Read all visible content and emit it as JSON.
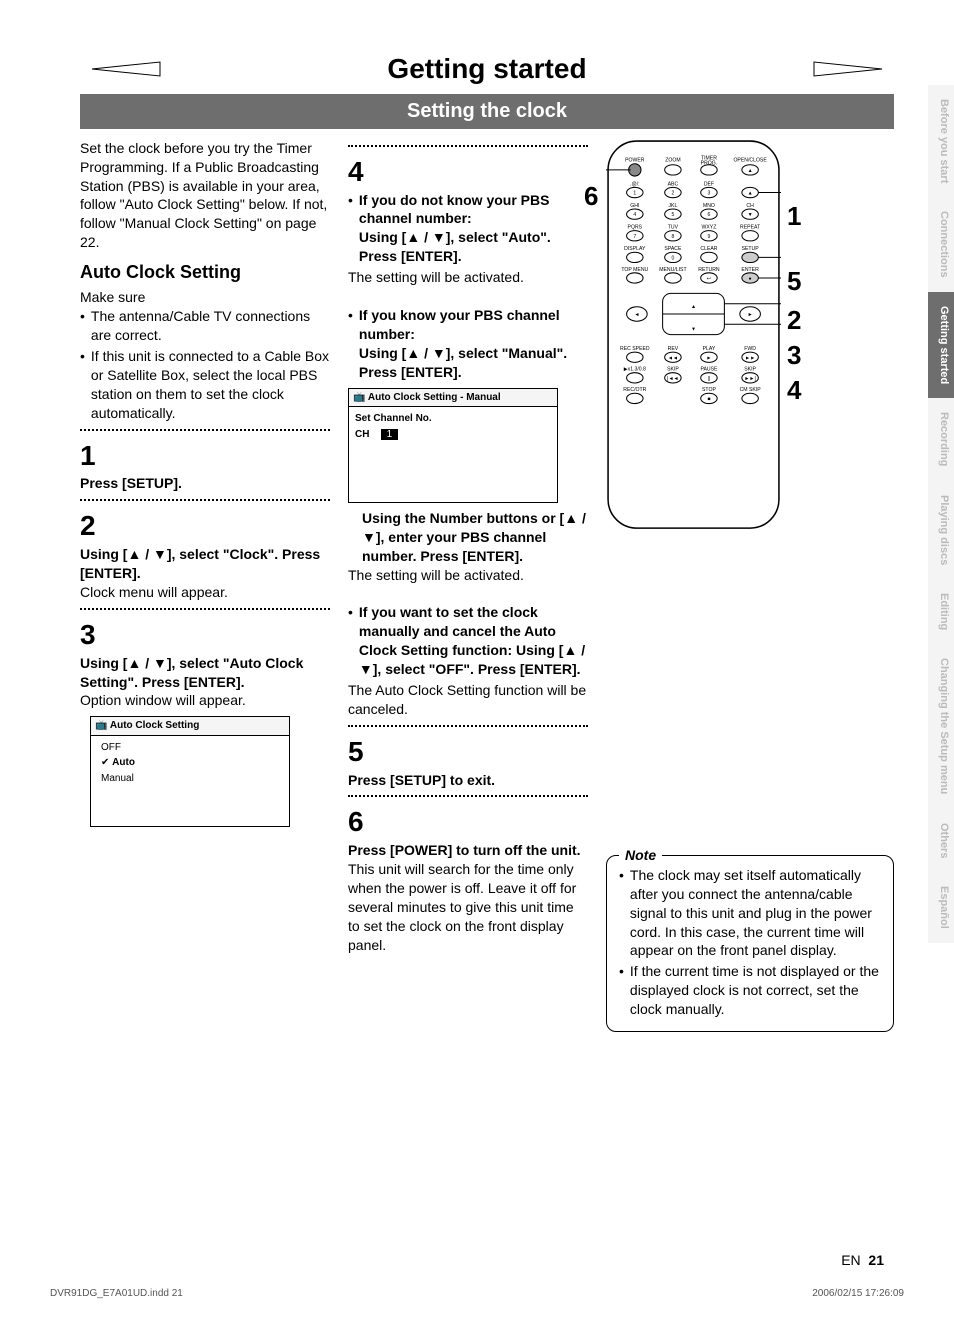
{
  "header": {
    "title": "Getting started",
    "subtitle": "Setting the clock"
  },
  "intro": "Set the clock before you try the Timer Programming. If a Public Broadcasting Station (PBS) is available in your area, follow \"Auto Clock Setting\" below. If not, follow \"Manual Clock Setting\" on page 22.",
  "autoClock": {
    "heading": "Auto Clock Setting",
    "makeSure": "Make sure",
    "bullets": [
      "The antenna/Cable TV connections are correct.",
      "If this unit is connected to a Cable Box or Satellite Box, select the local PBS station on them to set the clock automatically."
    ]
  },
  "steps": {
    "s1": {
      "num": "1",
      "bold": "Press [SETUP]."
    },
    "s2": {
      "num": "2",
      "bold": "Using [▲ / ▼], select \"Clock\". Press [ENTER].",
      "text": "Clock menu will appear."
    },
    "s3": {
      "num": "3",
      "bold": "Using [▲ / ▼], select \"Auto Clock Setting\". Press [ENTER].",
      "text": "Option window will appear."
    },
    "s4": {
      "num": "4",
      "b1_bold": "If you do not know your PBS channel number:",
      "b1_line": "Using [▲ / ▼], select \"Auto\". Press [ENTER].",
      "b1_text": "The setting will be activated.",
      "b2_bold": "If you know your PBS channel number:",
      "b2_line": "Using [▲ / ▼], select \"Manual\". Press [ENTER].",
      "num_bold": "Using the Number buttons or [▲ / ▼], enter your PBS channel number. Press [ENTER].",
      "num_text": "The setting will be activated.",
      "b3_bold": "If you want to set the clock manually and cancel the Auto Clock Setting function: Using [▲ / ▼], select \"OFF\". Press [ENTER].",
      "b3_text": "The Auto Clock Setting function will be canceled."
    },
    "s5": {
      "num": "5",
      "bold": "Press [SETUP] to exit."
    },
    "s6": {
      "num": "6",
      "bold": "Press [POWER] to turn off the unit.",
      "text": "This unit will search for the time only when the power is off. Leave it off for several minutes to give this unit time to set the clock on the front display panel."
    }
  },
  "osd1": {
    "title": "Auto Clock Setting",
    "items": [
      "OFF",
      "Auto",
      "Manual"
    ]
  },
  "osd2": {
    "title": "Auto Clock Setting - Manual",
    "line1": "Set Channel No.",
    "chLabel": "CH",
    "chVal": "1"
  },
  "note": {
    "title": "Note",
    "items": [
      "The clock may set itself automatically after you connect the antenna/cable signal to this unit and plug in the power cord. In this case, the current time will appear on the front panel display.",
      "If the current time is not displayed or the displayed clock is not correct, set the clock manually."
    ]
  },
  "remoteCallouts": {
    "c6": "6",
    "c1": "1",
    "c5": "5",
    "c2": "2",
    "c3": "3",
    "c4": "4"
  },
  "tabs": {
    "items": [
      "Before you start",
      "Connections",
      "Getting started",
      "Recording",
      "Playing discs",
      "Editing",
      "Changing the Setup menu",
      "Others",
      "Español"
    ]
  },
  "footer": {
    "lang": "EN",
    "page": "21"
  },
  "footerMeta": {
    "left": "DVR91DG_E7A01UD.indd   21",
    "right": "2006/02/15   17:26:09"
  },
  "remoteLabels": {
    "r1": [
      "POWER",
      "ZOOM",
      "TIMER PROG.",
      "OPEN/CLOSE"
    ],
    "r2": [
      ".@/:",
      "ABC",
      "DEF"
    ],
    "r3": [
      "GHI",
      "JKL",
      "MNO",
      "CH"
    ],
    "r4": [
      "PQRS",
      "TUV",
      "WXYZ",
      "REPEAT"
    ],
    "r5": [
      "DISPLAY",
      "SPACE",
      "CLEAR",
      "SETUP"
    ],
    "r6": [
      "TOP MENU",
      "MENU/LIST",
      "RETURN",
      "ENTER"
    ],
    "r7": [
      "REC SPEED",
      "REV",
      "PLAY",
      "FWD"
    ],
    "r8": [
      "▶x1.3/0.8",
      "SKIP",
      "PAUSE",
      "SKIP"
    ],
    "r9": [
      "REC/OTR",
      "",
      "STOP",
      "CM SKIP"
    ],
    "nums": [
      "1",
      "2",
      "3",
      "4",
      "5",
      "6",
      "7",
      "8",
      "9",
      "0"
    ]
  }
}
